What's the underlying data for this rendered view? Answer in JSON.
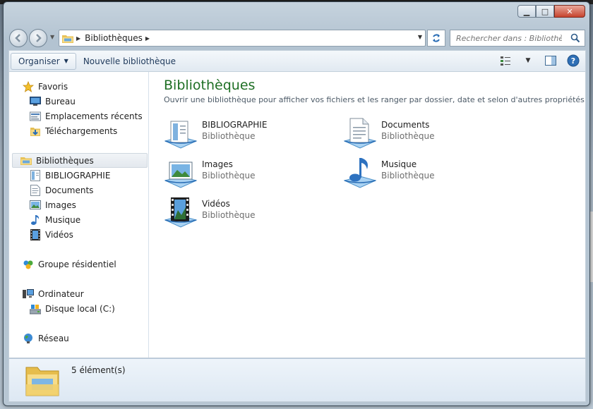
{
  "window": {
    "caption": {
      "minimize_glyph": "▁",
      "maximize_glyph": "□",
      "close_glyph": "✕"
    }
  },
  "address_bar": {
    "crumb": "Bibliothèques",
    "search_placeholder": "Rechercher dans : Bibliothè..."
  },
  "toolbar": {
    "organise_label": "Organiser",
    "new_library_label": "Nouvelle bibliothèque"
  },
  "nav_pane": {
    "favorites": {
      "label": "Favoris",
      "icon": "star-icon"
    },
    "favorites_items": [
      {
        "label": "Bureau",
        "icon": "desktop-icon"
      },
      {
        "label": "Emplacements récents",
        "icon": "recent-places-icon"
      },
      {
        "label": "Téléchargements",
        "icon": "downloads-icon"
      }
    ],
    "libraries": {
      "label": "Bibliothèques",
      "icon": "library-folder-icon"
    },
    "library_items": [
      {
        "label": "BIBLIOGRAPHIE",
        "icon": "document-library-icon"
      },
      {
        "label": "Documents",
        "icon": "documents-icon"
      },
      {
        "label": "Images",
        "icon": "images-icon"
      },
      {
        "label": "Musique",
        "icon": "music-icon"
      },
      {
        "label": "Vidéos",
        "icon": "videos-icon"
      }
    ],
    "homegroup": {
      "label": "Groupe résidentiel",
      "icon": "homegroup-icon"
    },
    "computer": {
      "label": "Ordinateur",
      "icon": "computer-icon"
    },
    "computer_items": [
      {
        "label": "Disque local (C:)",
        "icon": "local-disk-icon"
      }
    ],
    "network": {
      "label": "Réseau",
      "icon": "network-icon"
    }
  },
  "main": {
    "title": "Bibliothèques",
    "subtitle": "Ouvrir une bibliothèque pour afficher vos fichiers et les ranger par dossier, date et selon d'autres propriétés",
    "libraries": [
      {
        "name": "BIBLIOGRAPHIE",
        "type": "Bibliothèque",
        "icon": "document-library-icon"
      },
      {
        "name": "Documents",
        "type": "Bibliothèque",
        "icon": "documents-icon"
      },
      {
        "name": "Images",
        "type": "Bibliothèque",
        "icon": "images-icon"
      },
      {
        "name": "Musique",
        "type": "Bibliothèque",
        "icon": "music-icon"
      },
      {
        "name": "Vidéos",
        "type": "Bibliothèque",
        "icon": "videos-icon"
      }
    ]
  },
  "details": {
    "count": "5 élément(s)"
  },
  "colors": {
    "title_green": "#1e6f24",
    "link_blue": "#1e395b",
    "selection_bg": "#e3e8ee"
  }
}
